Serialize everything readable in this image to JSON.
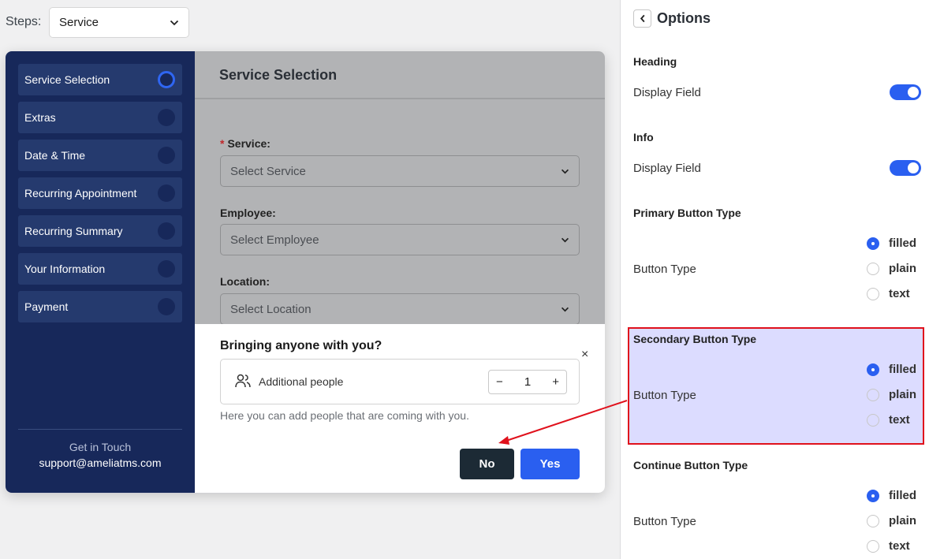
{
  "steps": {
    "label": "Steps:",
    "selected": "Service"
  },
  "sidebar": {
    "items": [
      {
        "label": "Service Selection"
      },
      {
        "label": "Extras"
      },
      {
        "label": "Date & Time"
      },
      {
        "label": "Recurring Appointment"
      },
      {
        "label": "Recurring Summary"
      },
      {
        "label": "Your Information"
      },
      {
        "label": "Payment"
      }
    ],
    "contact_title": "Get in Touch",
    "contact_email": "support@ameliatms.com"
  },
  "main": {
    "title": "Service Selection",
    "service_label": "Service:",
    "service_required": "*",
    "service_placeholder": "Select Service",
    "employee_label": "Employee:",
    "employee_placeholder": "Select Employee",
    "location_label": "Location:",
    "location_placeholder": "Select Location"
  },
  "popup": {
    "title": "Bringing anyone with you?",
    "close": "×",
    "people_label": "Additional people",
    "minus": "−",
    "plus": "+",
    "count": "1",
    "hint": "Here you can add people that are coming with you.",
    "no_label": "No",
    "yes_label": "Yes"
  },
  "panel": {
    "title": "Options",
    "heading": {
      "title": "Heading",
      "row": "Display Field"
    },
    "info": {
      "title": "Info",
      "row": "Display Field"
    },
    "primary": {
      "title": "Primary Button Type",
      "row": "Button Type",
      "options": [
        "filled",
        "plain",
        "text"
      ],
      "selected": "filled"
    },
    "secondary": {
      "title": "Secondary Button Type",
      "row": "Button Type",
      "options": [
        "filled",
        "plain",
        "text"
      ],
      "selected": "filled"
    },
    "continue": {
      "title": "Continue Button Type",
      "row": "Button Type",
      "options": [
        "filled",
        "plain",
        "text"
      ],
      "selected": "filled"
    }
  },
  "colors": {
    "accent": "#2a5ff0",
    "sidebar": "#17285a",
    "highlight_border": "#e0111c"
  }
}
